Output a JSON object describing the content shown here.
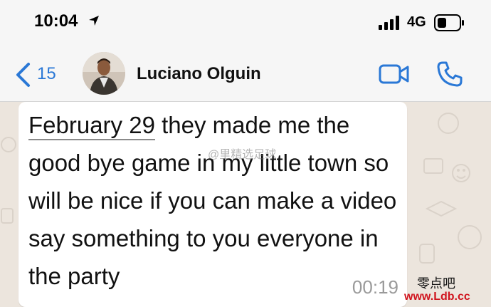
{
  "status_bar": {
    "time": "10:04",
    "network": "4G"
  },
  "nav": {
    "back_count": "15",
    "contact_name": "Luciano Olguin",
    "icons": [
      "chevron-left-icon",
      "video-camera-icon",
      "phone-icon"
    ],
    "accent_color": "#2a78d6"
  },
  "message": {
    "date_link": "February 29",
    "text_rest": " they made me the good bye game in my little town so will be nice if you can make a video say something to you everyone in the party",
    "time": "00:19"
  },
  "watermarks": {
    "center": "@里精选足球",
    "corner_cn": "零点吧",
    "corner_url": "www.Ldb.cc"
  }
}
